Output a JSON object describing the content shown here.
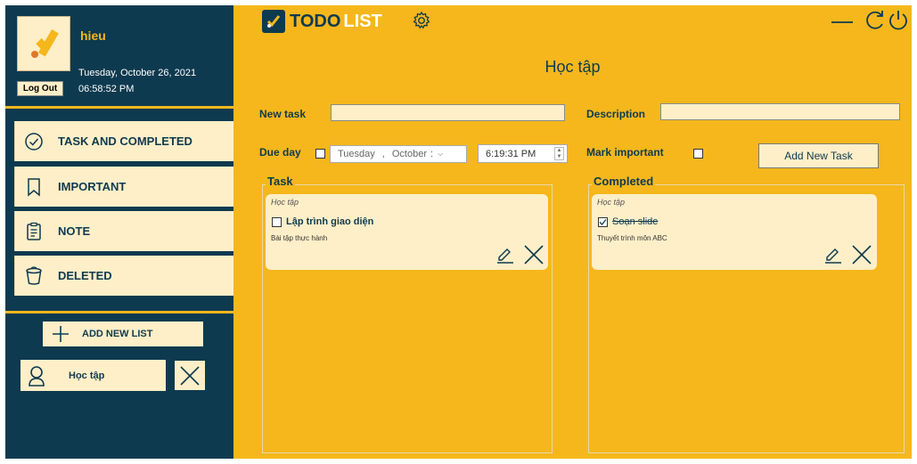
{
  "user": {
    "name": "hieu",
    "date": "Tuesday, October 26, 2021",
    "time": "06:58:52 PM",
    "logout_label": "Log Out"
  },
  "sidebar": {
    "items": [
      {
        "label": "TASK AND COMPLETED",
        "icon": "check-circle-icon"
      },
      {
        "label": "IMPORTANT",
        "icon": "bookmark-icon"
      },
      {
        "label": "NOTE",
        "icon": "clipboard-icon"
      },
      {
        "label": "DELETED",
        "icon": "trash-icon"
      }
    ],
    "add_list_label": "ADD NEW LIST",
    "lists": [
      {
        "label": "Học tập",
        "icon": "user-icon"
      }
    ]
  },
  "app": {
    "brand_todo": "TODO",
    "brand_list": "LIST"
  },
  "page": {
    "title": "Học tập"
  },
  "form": {
    "new_task_label": "New task",
    "new_task_value": "",
    "description_label": "Description",
    "description_value": "",
    "due_day_label": "Due day",
    "due_day_checked": false,
    "date_day": "Tuesday",
    "date_sep": ",",
    "date_month": "October",
    "date_tail": ":",
    "time_value": "6:19:31 PM",
    "mark_important_label": "Mark important",
    "mark_important_checked": false,
    "add_button": "Add New Task"
  },
  "task_group": {
    "title": "Task",
    "cards": [
      {
        "category": "Học tập",
        "title": "Lập trình giao diện",
        "description": "Bài tập thực hành",
        "checked": false
      }
    ]
  },
  "completed_group": {
    "title": "Completed",
    "cards": [
      {
        "category": "Học tập",
        "title": "Soạn slide",
        "description": "Thuyết trình môn ABC",
        "checked": true
      }
    ]
  },
  "colors": {
    "sidebar_bg": "#0e3a4f",
    "main_bg": "#f5b71c",
    "card_bg": "#ffefc8",
    "accent_text": "#0e3a4f"
  }
}
